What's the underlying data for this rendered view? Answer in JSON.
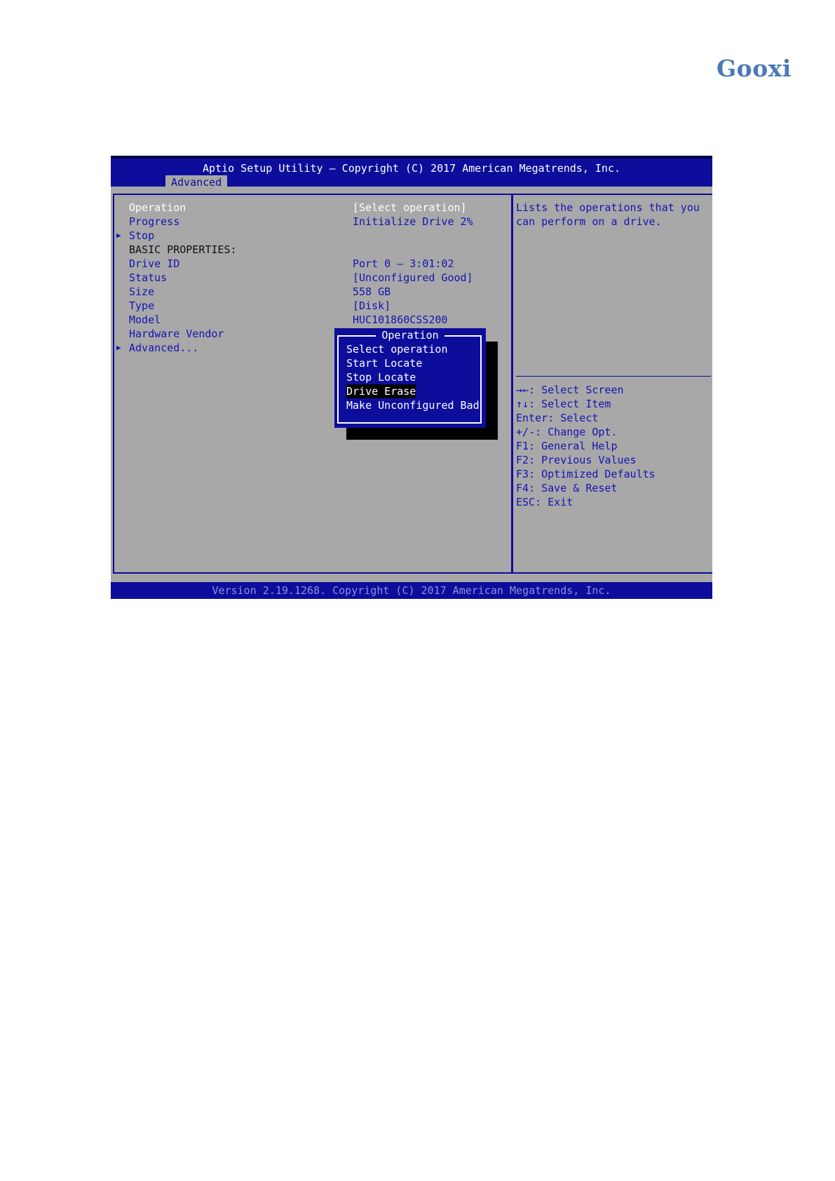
{
  "logo": "Gooxi",
  "header": {
    "title": "Aptio Setup Utility – Copyright (C) 2017 American Megatrends, Inc.",
    "tab": "Advanced"
  },
  "settings": [
    {
      "label": "Operation",
      "value": "[Select operation]"
    },
    {
      "label": "Progress",
      "value": "Initialize Drive 2%"
    },
    {
      "label": "Stop",
      "value": ""
    },
    {
      "label": "BASIC PROPERTIES:",
      "value": ""
    },
    {
      "label": "Drive ID",
      "value": "Port 0 – 3:01:02"
    },
    {
      "label": "Status",
      "value": "[Unconfigured Good]"
    },
    {
      "label": "Size",
      "value": "558 GB"
    },
    {
      "label": "Type",
      "value": "[Disk]"
    },
    {
      "label": "Model",
      "value": "HUC101860CSS200"
    },
    {
      "label": "Hardware Vendor",
      "value": ""
    },
    {
      "label": "Advanced...",
      "value": ""
    }
  ],
  "popup": {
    "title": "Operation",
    "options": [
      "Select operation",
      "Start Locate",
      "Stop Locate",
      "Drive Erase",
      "Make Unconfigured Bad"
    ],
    "selected": "Drive Erase"
  },
  "help": {
    "description": [
      "Lists the operations that you",
      "can perform on a drive."
    ],
    "keys": [
      "→←: Select Screen",
      "↑↓: Select Item",
      "Enter: Select",
      "+/-: Change Opt.",
      "F1: General Help",
      "F2: Previous Values",
      "F3: Optimized Defaults",
      "F4: Save & Reset",
      "ESC: Exit"
    ]
  },
  "footer": "Version 2.19.1268. Copyright (C) 2017 American Megatrends, Inc.",
  "colors": {
    "bios_blue": "#0d0d9c",
    "bios_gray": "#a8a8a8",
    "logo_blue": "#4a79b8"
  }
}
